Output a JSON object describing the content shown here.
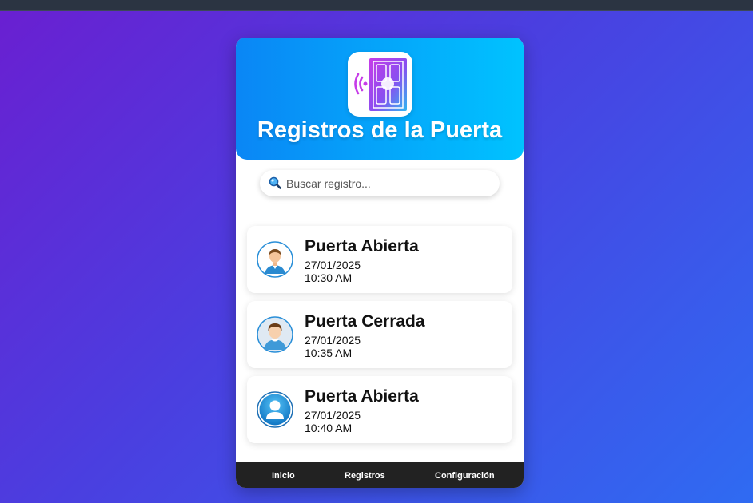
{
  "header": {
    "title": "Registros de la Puerta",
    "logo_icon": "door-wireless-icon"
  },
  "search": {
    "placeholder": "Buscar registro...",
    "value": "",
    "icon": "search-icon"
  },
  "records": [
    {
      "title": "Puerta Abierta",
      "date": "27/01/2025",
      "time": "10:30 AM",
      "avatar": "man-avatar-icon"
    },
    {
      "title": "Puerta Cerrada",
      "date": "27/01/2025",
      "time": "10:35 AM",
      "avatar": "boy-avatar-icon"
    },
    {
      "title": "Puerta Abierta",
      "date": "27/01/2025",
      "time": "10:40 AM",
      "avatar": "generic-user-icon"
    }
  ],
  "nav": {
    "items": [
      {
        "label": "Inicio"
      },
      {
        "label": "Registros"
      },
      {
        "label": "Configuración"
      }
    ]
  },
  "colors": {
    "header_gradient_start": "#0a86f5",
    "header_gradient_end": "#00c3ff",
    "nav_background": "#222222",
    "page_gradient_start": "#6a1fd1",
    "page_gradient_end": "#2f6bf2"
  }
}
